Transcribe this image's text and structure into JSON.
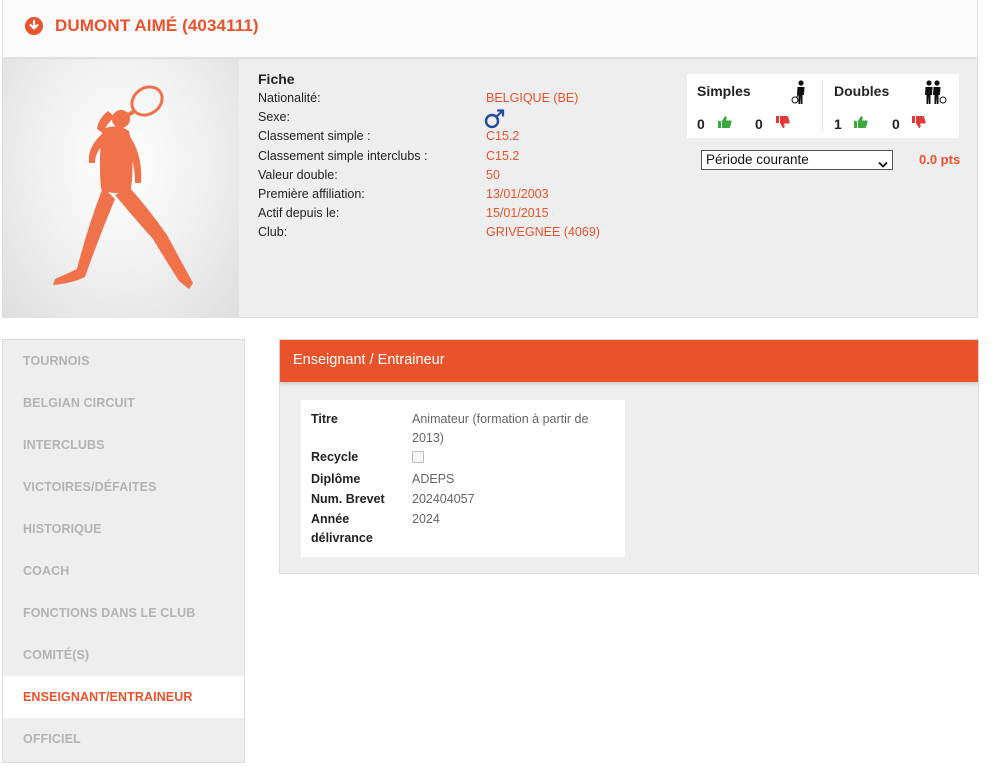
{
  "header": {
    "title": "DUMONT AIMÉ (4034111)"
  },
  "fiche": {
    "title": "Fiche",
    "rows": [
      {
        "label": "Nationalité:",
        "value": "BELGIQUE (BE)"
      },
      {
        "label": "Sexe:",
        "value": ""
      },
      {
        "label": "Classement simple :",
        "value": "C15.2"
      },
      {
        "label": "Classement simple interclubs :",
        "value": "C15.2"
      },
      {
        "label": "Valeur double:",
        "value": "50"
      },
      {
        "label": "Première affiliation:",
        "value": "13/01/2003"
      },
      {
        "label": "Actif depuis le:",
        "value": "15/01/2015"
      },
      {
        "label": "Club:",
        "value": "GRIVEGNEE (4069)"
      }
    ]
  },
  "stats": {
    "simples": {
      "label": "Simples",
      "wins": "0",
      "losses": "0"
    },
    "doubles": {
      "label": "Doubles",
      "wins": "1",
      "losses": "0"
    }
  },
  "period": {
    "selected": "Période courante",
    "points": "0.0 pts"
  },
  "sidebar": {
    "items": [
      {
        "label": "TOURNOIS"
      },
      {
        "label": "BELGIAN CIRCUIT"
      },
      {
        "label": "INTERCLUBS"
      },
      {
        "label": "VICTOIRES/DÉFAITES"
      },
      {
        "label": "HISTORIQUE"
      },
      {
        "label": "COACH"
      },
      {
        "label": "FONCTIONS DANS LE CLUB"
      },
      {
        "label": "COMITÉ(S)"
      },
      {
        "label": "ENSEIGNANT/ENTRAINEUR"
      },
      {
        "label": "OFFICIEL"
      }
    ]
  },
  "panel": {
    "title": "Enseignant / Entraineur",
    "titre": {
      "label": "Titre",
      "value": "Animateur (formation à partir de 2013)"
    },
    "recycle": {
      "label": "Recycle"
    },
    "diplome": {
      "label": "Diplôme",
      "value": "ADEPS"
    },
    "brevet": {
      "label": "Num. Brevet",
      "value": "202404057"
    },
    "annee": {
      "label": "Année délivrance",
      "value": "2024"
    }
  },
  "colors": {
    "accent": "#e8532b",
    "win": "#3aa83a",
    "loss": "#e03a3a",
    "male": "#1f4aa0"
  }
}
